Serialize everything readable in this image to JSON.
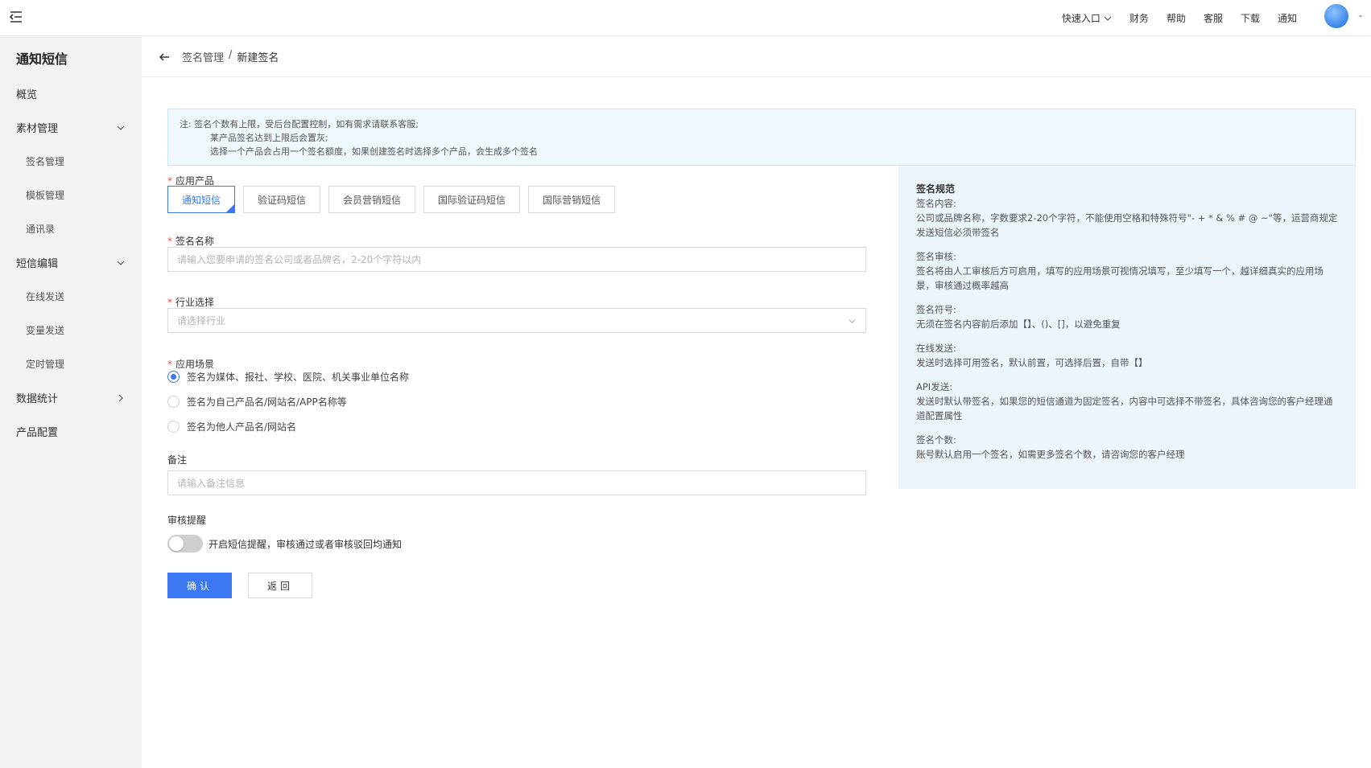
{
  "header": {
    "nav": [
      "快速入口",
      "财务",
      "帮助",
      "客服",
      "下载",
      "通知"
    ]
  },
  "sidebar": {
    "title": "通知短信",
    "items": [
      {
        "label": "概览"
      },
      {
        "label": "素材管理"
      },
      {
        "label": "签名管理"
      },
      {
        "label": "模板管理"
      },
      {
        "label": "通讯录"
      },
      {
        "label": "短信编辑"
      },
      {
        "label": "在线发送"
      },
      {
        "label": "变量发送"
      },
      {
        "label": "定时管理"
      },
      {
        "label": "数据统计"
      },
      {
        "label": "产品配置"
      }
    ]
  },
  "breadcrumb": {
    "parent": "签名管理",
    "separator": "/",
    "current": "新建签名"
  },
  "notice": {
    "line1": "注:  签名个数有上限，受后台配置控制，如有需求请联系客服;",
    "line2": "某产品签名达到上限后会置灰;",
    "line3": "选择一个产品会占用一个签名额度，如果创建签名时选择多个产品，会生成多个签名"
  },
  "form": {
    "product": {
      "label": "应用产品",
      "options": [
        "通知短信",
        "验证码短信",
        "会员营销短信",
        "国际验证码短信",
        "国际营销短信"
      ],
      "selected": "通知短信"
    },
    "sign_name": {
      "label": "签名名称",
      "value": "",
      "placeholder": "请输入您要申请的签名公司或者品牌名，2-20个字符以内"
    },
    "industry": {
      "label": "行业选择",
      "placeholder": "请选择行业"
    },
    "scene": {
      "label": "应用场景",
      "options": [
        "签名为媒体、报社、学校、医院、机关事业单位名称",
        "签名为自己产品名/网站名/APP名称等",
        "签名为他人产品名/网站名"
      ],
      "selected": "签名为媒体、报社、学校、医院、机关事业单位名称"
    },
    "remark": {
      "label": "备注",
      "value": "",
      "placeholder": "请输入备注信息"
    },
    "review": {
      "label": "审核提醒",
      "toggle_on": false,
      "toggle_text": "开启短信提醒，审核通过或者审核驳回均通知"
    },
    "confirm_label": "确认",
    "back_label": "返回"
  },
  "rules": {
    "title": "签名规范",
    "sections": [
      {
        "heading": "签名内容:",
        "body": "公司或品牌名称，字数要求2-20个字符，不能使用空格和特殊符号\"- + * & % # @ ~\"等，运营商规定发送短信必须带签名"
      },
      {
        "heading": "签名审核:",
        "body": "签名将由人工审核后方可启用，填写的应用场景可视情况填写，至少填写一个，越详细真实的应用场景，审核通过概率越高"
      },
      {
        "heading": "签名符号:",
        "body": "无须在签名内容前后添加【】、()、[]，以避免重复"
      },
      {
        "heading": "在线发送:",
        "body": "发送时选择可用签名，默认前置，可选择后置，自带【】"
      },
      {
        "heading": "API发送:",
        "body": "发送时默认带签名，如果您的短信通道为固定签名，内容中可选择不带签名，具体咨询您的客户经理通道配置属性"
      },
      {
        "heading": "签名个数:",
        "body": "账号默认启用一个签名，如需更多签名个数，请咨询您的客户经理"
      }
    ]
  },
  "colors": {
    "primary": "#3a77f0",
    "required": "#f04848",
    "notice_bg": "#eef8fd",
    "rules_bg": "#edf5fc",
    "sidebar_bg": "#f1f2f4"
  },
  "icons": {
    "menu_toggle": "menu-fold-icon",
    "back": "arrow-left-icon",
    "chevron": "chevron-down-icon"
  }
}
